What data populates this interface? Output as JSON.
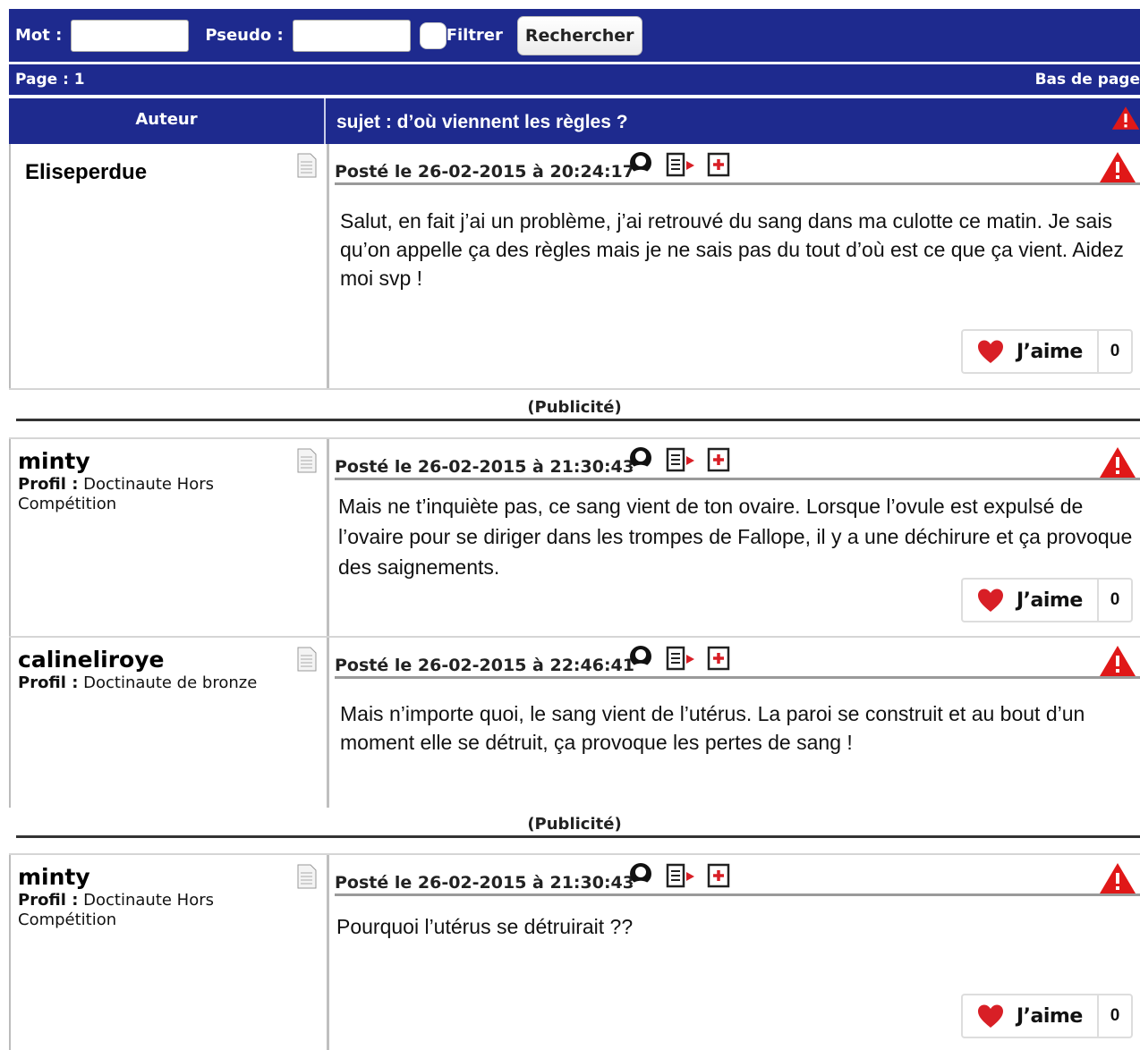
{
  "search": {
    "mot_label": "Mot :",
    "pseudo_label": "Pseudo :",
    "filter_label": "Filtrer",
    "search_button": "Rechercher"
  },
  "pagebar": {
    "page": "Page : 1",
    "bottom_link": "Bas de page"
  },
  "table_header": {
    "author_col": "Auteur",
    "subject": "sujet : d’où viennent les règles ?"
  },
  "ad_label": "(Publicité)",
  "posts": [
    {
      "author": "Eliseperdue",
      "profile_label": "",
      "profile_value": "",
      "date": "Posté le 26-02-2015 à 20:24:17",
      "message": "Salut, en fait j’ai un problème, j’ai retrouvé du sang dans ma culotte ce matin. Je sais qu’on appelle ça des règles mais je ne sais pas du tout d’où est ce que ça vient. Aidez moi svp !",
      "like_label": "J’aime",
      "like_count": "0"
    },
    {
      "author": "minty",
      "profile_label": "Profil :",
      "profile_value": "Doctinaute Hors Compétition",
      "date": "Posté le 26-02-2015 à 21:30:43",
      "message": "Mais ne t’inquiète pas, ce sang vient de ton ovaire. Lorsque l’ovule est expulsé de l’ovaire pour se diriger dans les trompes de Fallope, il y a une déchirure et ça provoque des saignements.",
      "like_label": "J’aime",
      "like_count": "0"
    },
    {
      "author": "calineliroye",
      "profile_label": "Profil :",
      "profile_value": "Doctinaute de bronze",
      "date": "Posté le 26-02-2015 à 22:46:41",
      "message": "Mais n’importe quoi, le sang vient de l’utérus. La paroi se construit et au bout d’un moment elle se détruit, ça provoque les pertes de sang !"
    },
    {
      "author": "minty",
      "profile_label": "Profil :",
      "profile_value": "Doctinaute Hors Compétition",
      "date": "Posté le 26-02-2015 à 21:30:43",
      "message": "Pourquoi l’utérus se détruirait ??",
      "like_label": "J’aime",
      "like_count": "0"
    }
  ],
  "colors": {
    "header_blue": "#1e2a8e",
    "alert_red": "#e01818",
    "heart_red": "#d81f26"
  }
}
